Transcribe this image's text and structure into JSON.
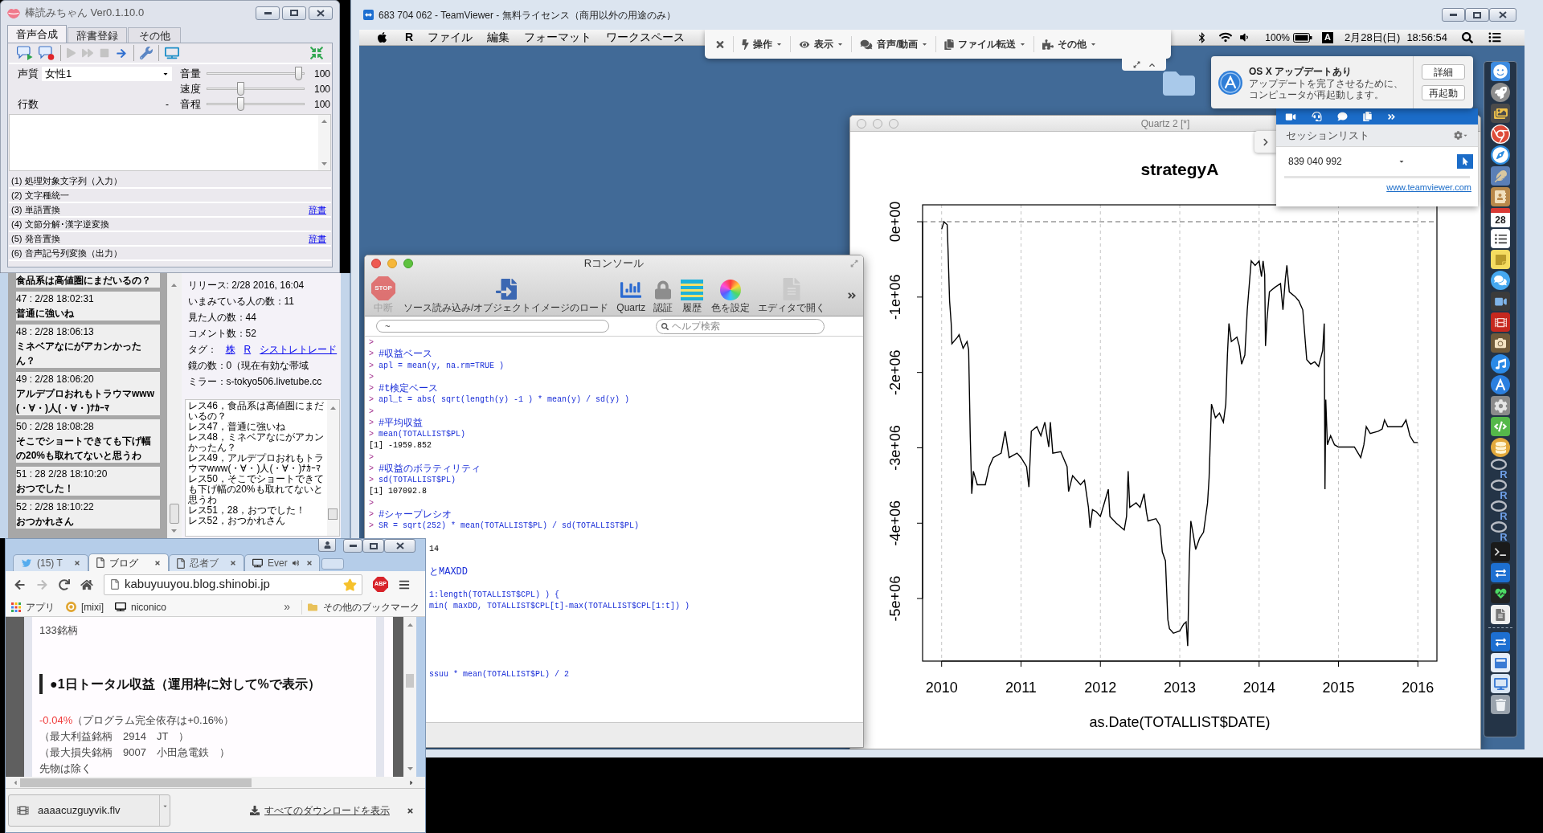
{
  "bouyomi": {
    "title": "棒読みちゃん Ver0.1.10.0",
    "tabs": [
      {
        "label": "音声合成",
        "selected": true
      },
      {
        "label": "辞書登録",
        "selected": false
      },
      {
        "label": "その他",
        "selected": false
      }
    ],
    "toolbar": [
      {
        "kind": "speak",
        "disabled": false
      },
      {
        "kind": "mute",
        "disabled": false
      },
      {
        "kind": "separator"
      },
      {
        "kind": "play",
        "disabled": true
      },
      {
        "kind": "fast-forward",
        "disabled": true
      },
      {
        "kind": "stop",
        "disabled": true
      },
      {
        "kind": "next",
        "disabled": false
      },
      {
        "kind": "separator"
      },
      {
        "kind": "settings",
        "disabled": false
      },
      {
        "kind": "separator"
      },
      {
        "kind": "tv",
        "disabled": false
      },
      {
        "kind": "compact",
        "disabled": false
      }
    ],
    "voice": {
      "label": "声質",
      "value": "女性1"
    },
    "rows": {
      "label": "行数",
      "value": "-"
    },
    "sliders": [
      {
        "label": "音量",
        "level": 0.97,
        "reading": "100"
      },
      {
        "label": "速度",
        "level": 0.34,
        "reading": "100"
      },
      {
        "label": "音程",
        "level": 0.34,
        "reading": "100"
      }
    ],
    "steps": [
      {
        "label": "(1) 処理対象文字列（入力）"
      },
      {
        "label": "(2) 文字種統一"
      },
      {
        "label": "(3) 単語置換",
        "link": "辞書"
      },
      {
        "label": "(4) 文節分解･漢字逆変換"
      },
      {
        "label": "(5) 発音置換",
        "link": "辞書"
      },
      {
        "label": "(6) 音声記号列変換（出力）"
      }
    ]
  },
  "livetube": {
    "comments": [
      {
        "text": "食品系は高値圏にまだいるの？"
      },
      {
        "header": "47 : 2/28 18:02:31",
        "text": "普通に強いね"
      },
      {
        "header": "48 : 2/28 18:06:13",
        "text": "ミネベアなにがアカンかったん？"
      },
      {
        "header": "49 : 2/28 18:06:20",
        "text": "アルデプロおれもトラウマwww(・∀・)人(・∀・)ﾅｶｰﾏ"
      },
      {
        "header": "50 : 2/28 18:08:28",
        "text": "そこでショートできても下げ幅の20%も取れてないと思うわ"
      },
      {
        "header": "51 : 28 2/28 18:10:20",
        "text": "おつでした！"
      },
      {
        "header": "52 : 2/28 18:10:22",
        "text": "おつかれさん"
      }
    ],
    "info": [
      {
        "kind": "text",
        "text": "リリース: 2/28 2016, 16:04"
      },
      {
        "kind": "text",
        "text": "いまみている人の数：11"
      },
      {
        "kind": "text",
        "text": "見た人の数：44"
      },
      {
        "kind": "text",
        "text": "コメント数：52"
      },
      {
        "kind": "tags",
        "label": "タグ：",
        "tags": [
          "株",
          "R",
          "シストレトレード"
        ]
      },
      {
        "kind": "text",
        "text": "鏡の数：0（現在有効な帯域"
      },
      {
        "kind": "text",
        "text": "ミラー：s-tokyo506.livetube.cc"
      }
    ],
    "log": [
      "レス46，食品系は高値圏にまだいるの？",
      "レス47，普通に強いね",
      "レス48，ミネベアなにがアカンかったん？",
      "レス49，アルデプロおれもトラウマwww(・∀・)人(・∀・)ﾅｶｰﾏ",
      "レス50，そこでショートできても下げ幅の20%も取れてないと思うわ",
      "レス51，28，おつでした！",
      "レス52，おつかれさん"
    ]
  },
  "teamviewer": {
    "title": "683 704 062 - TeamViewer - 無料ライセンス（商用以外の用途のみ）",
    "menubar": {
      "app": "R",
      "menus": [
        "ファイル",
        "編集",
        "フォーマット",
        "ワークスペース"
      ],
      "battery": "100%",
      "input": "A",
      "date": "2月28日(日)",
      "time": "18:56:54"
    },
    "toolbar": [
      {
        "kind": "close"
      },
      {
        "kind": "bolt",
        "label": "操作"
      },
      {
        "kind": "eye",
        "label": "表示"
      },
      {
        "kind": "chat",
        "label": "音声/動画"
      },
      {
        "kind": "file",
        "label": "ファイル転送"
      },
      {
        "kind": "puzzle",
        "label": "その他"
      }
    ],
    "notification": {
      "title": "OS X アップデートあり",
      "body": "アップデートを完了させるために、コンピュータが再起動します。",
      "buttons": [
        "詳細",
        "再起動"
      ]
    },
    "session_panel": {
      "title": "セッションリスト",
      "session": "839 040 992",
      "link": "www.teamviewer.com"
    },
    "quartz": {
      "title": "Quartz 2 [*]",
      "chart_data": {
        "type": "line",
        "title": "strategyA",
        "xlabel": "as.Date(TOTALLIST$DATE)",
        "x": [
          2010.0,
          2010.03,
          2010.07,
          2010.08,
          2010.1,
          2010.12,
          2010.13,
          2010.2,
          2010.22,
          2010.27,
          2010.32,
          2010.34,
          2010.36,
          2010.38,
          2010.4,
          2010.45,
          2010.55,
          2010.6,
          2010.65,
          2010.75,
          2010.8,
          2010.85,
          2010.95,
          2011.0,
          2011.07,
          2011.1,
          2011.13,
          2011.2,
          2011.25,
          2011.3,
          2011.35,
          2011.37,
          2011.4,
          2011.5,
          2011.58,
          2011.6,
          2011.65,
          2011.75,
          2011.8,
          2011.85,
          2011.87,
          2011.9,
          2011.95,
          2012.0,
          2012.05,
          2012.1,
          2012.12,
          2012.2,
          2012.3,
          2012.33,
          2012.35,
          2012.37,
          2012.45,
          2012.5,
          2012.55,
          2012.58,
          2012.6,
          2012.7,
          2012.75,
          2012.78,
          2012.82,
          2012.85,
          2012.87,
          2012.92,
          2013.0,
          2013.05,
          2013.08,
          2013.1,
          2013.12,
          2013.14,
          2013.17,
          2013.2,
          2013.25,
          2013.3,
          2013.35,
          2013.37,
          2013.4,
          2013.45,
          2013.5,
          2013.55,
          2013.58,
          2013.6,
          2013.62,
          2013.65,
          2013.72,
          2013.75,
          2013.78,
          2013.82,
          2013.85,
          2013.9,
          2013.95,
          2014.0,
          2014.03,
          2014.05,
          2014.07,
          2014.08,
          2014.1,
          2014.13,
          2014.2,
          2014.27,
          2014.3,
          2014.33,
          2014.35,
          2014.38,
          2014.45,
          2014.5,
          2014.55,
          2014.6,
          2014.65,
          2014.7,
          2014.75,
          2014.8,
          2014.82,
          2014.83,
          2014.84,
          2014.86,
          2014.9,
          2014.95,
          2015.0,
          2015.1,
          2015.2,
          2015.28,
          2015.32,
          2015.35,
          2015.4,
          2015.5,
          2015.55,
          2015.58,
          2015.62,
          2015.7,
          2015.8,
          2015.85,
          2015.9,
          2015.95,
          2016.0
        ],
        "series": [
          {
            "color": "#000000",
            "values": [
              -100000,
              0,
              -40000,
              -350000,
              -1050000,
              -1350000,
              -1620000,
              -1530000,
              -1500000,
              -1680000,
              -1590000,
              -1700000,
              -2840000,
              -3610000,
              -3310000,
              -3490000,
              -3490000,
              -3250000,
              -3130000,
              -3070000,
              -2780000,
              -3130000,
              -3070000,
              -3130000,
              -3250000,
              -3520000,
              -2780000,
              -2720000,
              -2840000,
              -2660000,
              -2990000,
              -2660000,
              -3070000,
              -3050000,
              -3250000,
              -3580000,
              -3370000,
              -3490000,
              -3430000,
              -3790000,
              -4060000,
              -3820000,
              -3850000,
              -3910000,
              -3730000,
              -3550000,
              -3910000,
              -4000000,
              -4090000,
              -3910000,
              -3310000,
              -3790000,
              -3730000,
              -3790000,
              -3610000,
              -3850000,
              -3970000,
              -3940000,
              -4030000,
              -4380000,
              -4500000,
              -5280000,
              -5400000,
              -5460000,
              -5430000,
              -5340000,
              -5310000,
              -5630000,
              -4500000,
              -3970000,
              -4150000,
              -4350000,
              -4200000,
              -4120000,
              -3730000,
              -3400000,
              -2420000,
              -2600000,
              -2540000,
              -2660000,
              -2420000,
              -1770000,
              -1350000,
              -1590000,
              -1530000,
              -1650000,
              -1890000,
              -1770000,
              -1170000,
              -520000,
              -580000,
              -520000,
              -730000,
              -520000,
              -700000,
              -1650000,
              -1290000,
              -930000,
              -870000,
              -820000,
              -1170000,
              -760000,
              -580000,
              -930000,
              -990000,
              -1050000,
              -1170000,
              -1830000,
              -1890000,
              -1860000,
              -1920000,
              -1710000,
              -1350000,
              -3550000,
              -2360000,
              -2960000,
              -2840000,
              -2960000,
              -2990000,
              -2990000,
              -2990000,
              -3130000,
              -2960000,
              -2720000,
              -2810000,
              -2780000,
              -2750000,
              -2630000,
              -2720000,
              -2720000,
              -2720000,
              -2630000,
              -2840000,
              -2930000,
              -2930000
            ]
          }
        ],
        "xlim": [
          2009.76,
          2016.24
        ],
        "ylim": [
          -5830000,
          224000
        ],
        "xticks": [
          2010,
          2011,
          2012,
          2013,
          2014,
          2015,
          2016
        ],
        "yticks": [
          {
            "value": 0,
            "label": "0e+00"
          },
          {
            "value": -1000000,
            "label": "-1e+06"
          },
          {
            "value": -2000000,
            "label": "-2e+06"
          },
          {
            "value": -3000000,
            "label": "-3e+06"
          },
          {
            "value": -4000000,
            "label": "-4e+06"
          },
          {
            "value": -5000000,
            "label": "-5e+06"
          }
        ],
        "grid": true,
        "ref_lines": [
          {
            "axis": "y",
            "value": 0
          }
        ]
      }
    },
    "r_console": {
      "title": "Rコンソール",
      "toolbar": [
        {
          "kind": "stop",
          "sign": "STOP",
          "label": "中断",
          "disabled": true
        },
        {
          "kind": "source",
          "label": "ソース読み込み/オブジェクトイメージのロード",
          "disabled": false
        },
        {
          "kind": "chart",
          "label": "Quartz",
          "disabled": false
        },
        {
          "kind": "lock",
          "label": "認証",
          "disabled": false
        },
        {
          "kind": "history",
          "label": "履歴",
          "disabled": false
        },
        {
          "kind": "colors",
          "label": "色を設定",
          "disabled": false
        },
        {
          "kind": "editor",
          "label": "エディタで開く",
          "disabled": false
        }
      ],
      "path": "~",
      "search_placeholder": "ヘルプ検索",
      "lines": [
        {
          "kind": "prompt",
          "prompt": ">"
        },
        {
          "kind": "comment",
          "prompt": ">",
          "text": "#収益ベース"
        },
        {
          "kind": "command",
          "prompt": ">",
          "text": "apl = mean(y, na.rm=TRUE )"
        },
        {
          "kind": "prompt",
          "prompt": ">"
        },
        {
          "kind": "comment",
          "prompt": ">",
          "text": "#t検定ベース"
        },
        {
          "kind": "command",
          "prompt": ">",
          "text": "apl_t = abs( sqrt(length(y) -1 ) * mean(y) / sd(y) )"
        },
        {
          "kind": "prompt",
          "prompt": ">"
        },
        {
          "kind": "comment",
          "prompt": ">",
          "text": "#平均収益"
        },
        {
          "kind": "command",
          "prompt": ">",
          "text": "mean(TOTALLIST$PL)"
        },
        {
          "kind": "output",
          "text": "[1] -1959.852"
        },
        {
          "kind": "prompt",
          "prompt": ">"
        },
        {
          "kind": "comment",
          "prompt": ">",
          "text": "#収益のボラティリティ"
        },
        {
          "kind": "command",
          "prompt": ">",
          "text": "sd(TOTALLIST$PL)"
        },
        {
          "kind": "output",
          "text": "[1] 107092.8"
        },
        {
          "kind": "prompt",
          "prompt": ">"
        },
        {
          "kind": "comment",
          "prompt": ">",
          "text": "#シャープレシオ"
        },
        {
          "kind": "command",
          "prompt": ">",
          "text": "SR = sqrt(252) * mean(TOTALLIST$PL) / sd(TOTALLIST$PL)"
        },
        {
          "kind": "clipped-output",
          "text": "14"
        },
        {
          "kind": "clipped-comment",
          "text": "とMAXDD"
        },
        {
          "kind": "clipped-command",
          "text": "1:length(TOTALLIST$CPL) ) {"
        },
        {
          "kind": "clipped-command",
          "text": "min( maxDD, TOTALLIST$CPL[t]-max(TOTALLIST$CPL[1:t]) )"
        },
        {
          "kind": "clipped-command",
          "text": "ssuu * mean(TOTALLIST$PL) / 2"
        }
      ]
    },
    "dock": [
      {
        "kind": "finder"
      },
      {
        "kind": "rocket"
      },
      {
        "kind": "pictures"
      },
      {
        "kind": "browser"
      },
      {
        "kind": "compass"
      },
      {
        "kind": "feather"
      },
      {
        "kind": "contacts"
      },
      {
        "kind": "calendar",
        "text": "28"
      },
      {
        "kind": "checklist"
      },
      {
        "kind": "notes"
      },
      {
        "kind": "messages"
      },
      {
        "kind": "video"
      },
      {
        "kind": "film"
      },
      {
        "kind": "camera"
      },
      {
        "kind": "music"
      },
      {
        "kind": "store"
      },
      {
        "kind": "settings"
      },
      {
        "kind": "code"
      },
      {
        "kind": "database"
      },
      {
        "kind": "r",
        "text": "R"
      },
      {
        "kind": "r",
        "text": "R"
      },
      {
        "kind": "r",
        "text": "R"
      },
      {
        "kind": "r",
        "text": "R"
      },
      {
        "kind": "terminal"
      },
      {
        "kind": "remote"
      },
      {
        "kind": "monitor"
      },
      {
        "kind": "script"
      },
      {
        "kind": "separator"
      },
      {
        "kind": "remote"
      },
      {
        "kind": "window"
      },
      {
        "kind": "screen"
      },
      {
        "kind": "trash"
      }
    ]
  },
  "browser": {
    "tabs": [
      {
        "kind": "bird",
        "label": "(15) T",
        "selected": false,
        "audio": false
      },
      {
        "kind": "page",
        "label": "ブログ",
        "selected": true,
        "audio": false
      },
      {
        "kind": "page",
        "label": "忍者ブ",
        "selected": false,
        "audio": false
      },
      {
        "kind": "tv",
        "label": "Ever",
        "selected": false,
        "audio": true
      }
    ],
    "nav": [
      {
        "kind": "back",
        "disabled": false
      },
      {
        "kind": "forward",
        "disabled": true
      },
      {
        "kind": "reload",
        "disabled": false
      },
      {
        "kind": "home",
        "disabled": false
      }
    ],
    "url": "kabuyuuyou.blog.shinobi.jp",
    "starred": true,
    "extension": "ABP",
    "bookmarks": [
      {
        "kind": "apps",
        "label": "アプリ"
      },
      {
        "kind": "circle",
        "label": "[mixi]"
      },
      {
        "kind": "tv",
        "label": "niconico"
      }
    ],
    "more": "»",
    "other_bookmarks": "その他のブックマーク",
    "page": {
      "count": "133銘柄",
      "heading": "●1日トータル収益（運用枠に対して%で表示）",
      "result": {
        "value": "-0.04%",
        "note": "（プログラム完全依存は+0.16%）"
      },
      "lines": [
        "（最大利益銘柄　2914　JT　）",
        "（最大損失銘柄　9007　小田急電鉄　）",
        "先物は除く"
      ]
    },
    "downloads": {
      "file": "aaaacuzguyvik.flv",
      "show_all": "すべてのダウンロードを表示"
    }
  }
}
